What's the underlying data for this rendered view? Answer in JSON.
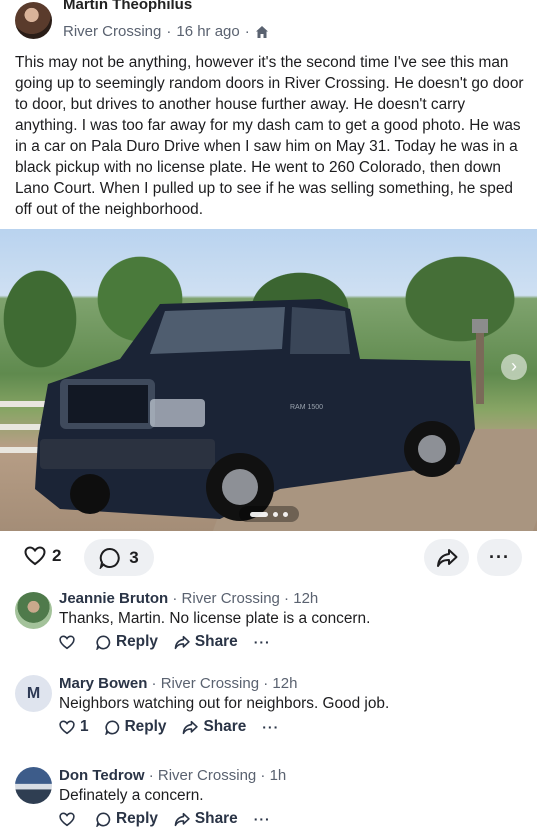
{
  "post": {
    "author": "Martin Theophilus",
    "neighborhood": "River Crossing",
    "time": "16 hr ago",
    "separator": "·",
    "audience_icon": "home-icon",
    "body": "This may not be anything, however it's the second time I've see this man going up to seemingly random doors in River Crossing. He doesn't go door to door, but drives to another house further away. He doesn't carry anything. I was too far away for my dash cam to get a good photo. He was in a car on Pala Duro Drive when I saw him on May 31. Today he was in a black pickup with no license plate. He went to 260 Colorado, then down Lano Court. When I pulled up to see if he was selling something, he sped off out of the neighborhood.",
    "photo": {
      "truck_badge": "RAM 1500",
      "carousel_index": 1,
      "carousel_count": 3
    },
    "reactions": {
      "likes": "2",
      "comments": "3"
    }
  },
  "comments": [
    {
      "name": "Jeannie Bruton",
      "neighborhood": "River Crossing",
      "time": "12h",
      "text": "Thanks, Martin. No license plate is a concern.",
      "likes": "",
      "reply_label": "Reply",
      "share_label": "Share",
      "more": "···"
    },
    {
      "name": "Mary Bowen",
      "avatar_letter": "M",
      "neighborhood": "River Crossing",
      "time": "12h",
      "text": "Neighbors watching out for neighbors.  Good job.",
      "likes": "1",
      "reply_label": "Reply",
      "share_label": "Share",
      "more": "···"
    },
    {
      "name": "Don Tedrow",
      "neighborhood": "River Crossing",
      "time": "1h",
      "text": "Definately a concern.",
      "likes": "",
      "reply_label": "Reply",
      "share_label": "Share",
      "more": "···"
    }
  ],
  "colors": {
    "text": "#1d1d1f",
    "meta": "#5a6270",
    "button_bg": "#eef0f3"
  }
}
